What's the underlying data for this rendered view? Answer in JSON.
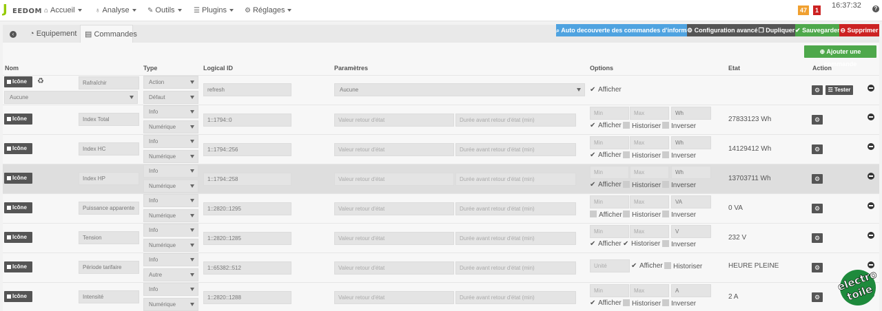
{
  "app": {
    "logo_letter": "J",
    "logo_text": "EEDOM",
    "clock": "16:37:32",
    "badge_orange": "47",
    "badge_red": "1",
    "help_glyph": "?"
  },
  "nav": [
    {
      "label": "Accueil",
      "icon": "home-icon"
    },
    {
      "label": "Analyse",
      "icon": "stethoscope-icon"
    },
    {
      "label": "Outils",
      "icon": "wrench-icon"
    },
    {
      "label": "Plugins",
      "icon": "list-icon"
    },
    {
      "label": "Réglages",
      "icon": "cogs-icon"
    }
  ],
  "tabs": {
    "equipement": "Equipement",
    "commandes": "Commandes"
  },
  "toolbar": {
    "autodetect": "Auto decouverte des commandes d'information",
    "advanced": "Configuration avancée",
    "duplicate": "Dupliquer",
    "save": "Sauvegarder",
    "delete": "Supprimer",
    "add_command": "Ajouter une commande"
  },
  "headers": {
    "nom": "Nom",
    "type": "Type",
    "logical_id": "Logical ID",
    "parametres": "Paramètres",
    "options": "Options",
    "etat": "Etat",
    "action": "Action"
  },
  "labels": {
    "icone": "Icône",
    "afficher": "Afficher",
    "historiser": "Historiser",
    "inverser": "Inverser",
    "tester": "Tester",
    "valeur_retour_ph": "Valeur retour d'état",
    "duree_retour_ph": "Durée avant retour d'état (min)",
    "min_ph": "Min",
    "max_ph": "Max",
    "unite_ph": "Unité"
  },
  "rows": [
    {
      "name": "Rafraîchir",
      "type": "Action",
      "subtype": "Défaut",
      "logical_id": "refresh",
      "param_select": "Aucune",
      "extra_select": "Aucune",
      "kind": "action",
      "afficher": true
    },
    {
      "name": "Index Total",
      "type": "Info",
      "subtype": "Numérique",
      "logical_id": "1::1794::0",
      "unit": "Wh",
      "etat": "27833123 Wh",
      "kind": "info",
      "afficher": true,
      "historiser": false,
      "inverser": false
    },
    {
      "name": "Index HC",
      "type": "Info",
      "subtype": "Numérique",
      "logical_id": "1::1794::256",
      "unit": "Wh",
      "etat": "14129412 Wh",
      "kind": "info",
      "afficher": true,
      "historiser": false,
      "inverser": false
    },
    {
      "name": "Index HP",
      "type": "Info",
      "subtype": "Numérique",
      "logical_id": "1::1794::258",
      "unit": "Wh",
      "etat": "13703711 Wh",
      "kind": "info",
      "afficher": true,
      "historiser": false,
      "inverser": false
    },
    {
      "name": "Puissance apparente",
      "type": "Info",
      "subtype": "Numérique",
      "logical_id": "1::2820::1295",
      "unit": "VA",
      "etat": "0 VA",
      "kind": "info",
      "afficher": false,
      "historiser": false,
      "inverser": false
    },
    {
      "name": "Tension",
      "type": "Info",
      "subtype": "Numérique",
      "logical_id": "1::2820::1285",
      "unit": "V",
      "etat": "232 V",
      "kind": "info",
      "afficher": true,
      "historiser": true,
      "inverser": false
    },
    {
      "name": "Période tarifaire",
      "type": "Info",
      "subtype": "Autre",
      "logical_id": "1::65382::512",
      "etat": "HEURE PLEINE",
      "kind": "other",
      "afficher": true,
      "historiser": false
    },
    {
      "name": "Intensité",
      "type": "Info",
      "subtype": "Numérique",
      "logical_id": "1::2820::1288",
      "unit": "A",
      "etat": "2 A",
      "kind": "info",
      "afficher": true,
      "historiser": false,
      "inverser": false
    }
  ],
  "watermark": {
    "line1": "electro",
    "line2": "toile"
  },
  "colors": {
    "blue": "#4fa3e0",
    "gray": "#555555",
    "green": "#4ea84b",
    "red": "#cc2222",
    "orange": "#f0a030"
  }
}
